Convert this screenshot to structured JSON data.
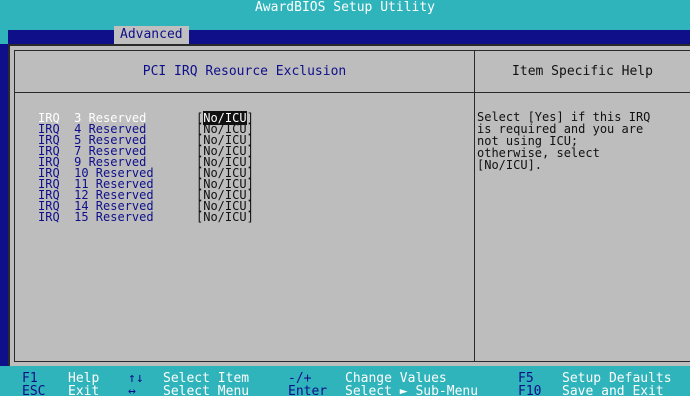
{
  "header": {
    "title": "AwardBIOS Setup Utility"
  },
  "menu": {
    "active_tab": "Advanced"
  },
  "panel": {
    "title": "PCI IRQ Resource Exclusion",
    "help_title": "Item Specific Help"
  },
  "items": [
    {
      "label": "IRQ  3 Reserved",
      "value": "[No/ICU]",
      "selected": true
    },
    {
      "label": "IRQ  4 Reserved",
      "value": "[No/ICU]"
    },
    {
      "label": "IRQ  5 Reserved",
      "value": "[No/ICU]"
    },
    {
      "label": "IRQ  7 Reserved",
      "value": "[No/ICU]"
    },
    {
      "label": "IRQ  9 Reserved",
      "value": "[No/ICU]"
    },
    {
      "label": "IRQ  10 Reserved",
      "value": "[No/ICU]"
    },
    {
      "label": "IRQ  11 Reserved",
      "value": "[No/ICU]"
    },
    {
      "label": "IRQ  12 Reserved",
      "value": "[No/ICU]"
    },
    {
      "label": "IRQ  14 Reserved",
      "value": "[No/ICU]"
    },
    {
      "label": "IRQ  15 Reserved",
      "value": "[No/ICU]"
    }
  ],
  "selected_value": {
    "open": "[",
    "text": "No/ICU",
    "close": "]"
  },
  "help": {
    "lines": [
      "Select [Yes] if this IRQ",
      "is required and you are",
      "not using ICU;",
      "otherwise, select",
      "[No/ICU]."
    ]
  },
  "footer": {
    "f1_key": "F1",
    "f1_label": "Help",
    "esc_key": "ESC",
    "esc_label": "Exit",
    "updown_key": "↑↓",
    "updown_label": "Select Item",
    "leftright_key": "↔",
    "leftright_label": "Select Menu",
    "minusplus_key": "-/+",
    "minusplus_label": "Change Values",
    "enter_key": "Enter",
    "enter_label": "Select ► Sub-Menu",
    "f5_key": "F5",
    "f5_label": "Setup Defaults",
    "f10_key": "F10",
    "f10_label": "Save and Exit"
  },
  "colors": {
    "bios_blue": "#0f0f8a",
    "bios_cyan": "#2fb4bb",
    "panel_gray": "#bdbdbd",
    "highlight": "#111111"
  }
}
